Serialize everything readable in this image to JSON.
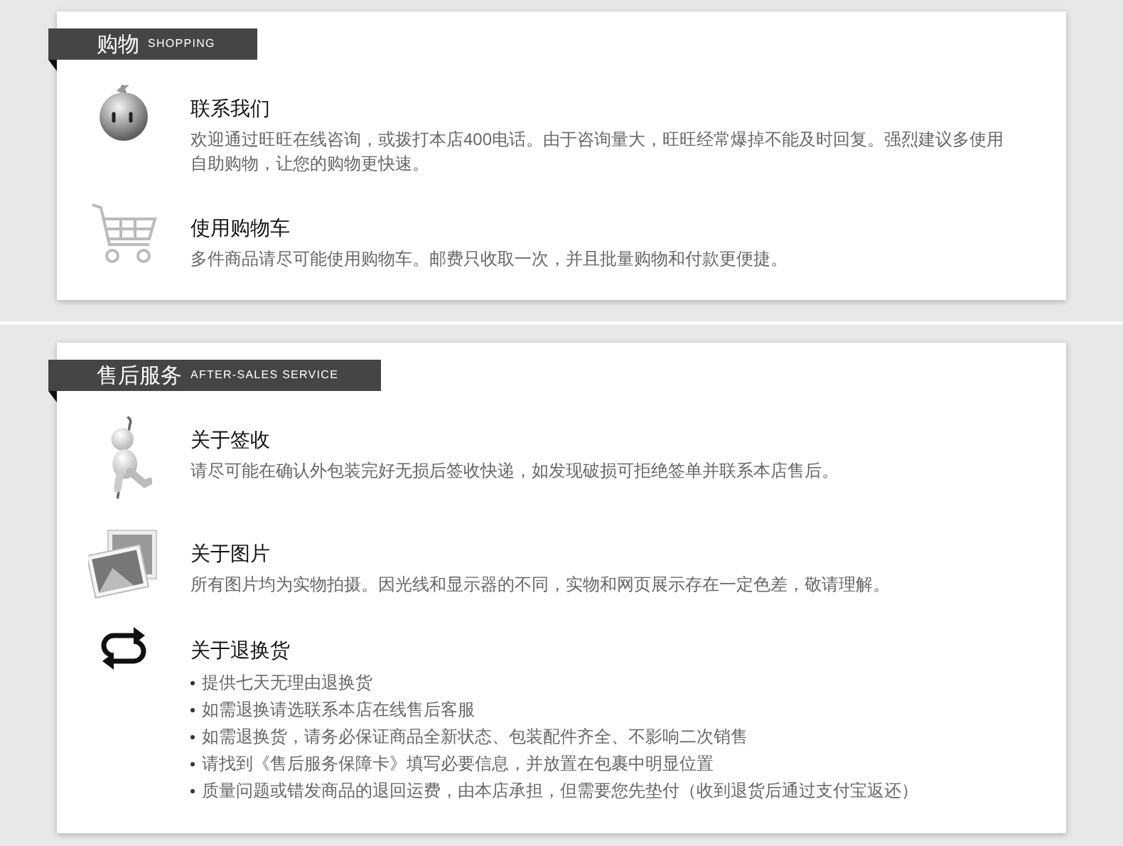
{
  "sections": [
    {
      "title": "购物",
      "subtitle": "SHOPPING",
      "items": [
        {
          "title": "联系我们",
          "text": "欢迎通过旺旺在线咨询，或拨打本店400电话。由于咨询量大，旺旺经常爆掉不能及时回复。强烈建议多使用自助购物，让您的购物更快速。"
        },
        {
          "title": "使用购物车",
          "text": "多件商品请尽可能使用购物车。邮费只收取一次，并且批量购物和付款更便捷。"
        }
      ]
    },
    {
      "title": "售后服务",
      "subtitle": "AFTER-SALES SERVICE",
      "items": [
        {
          "title": "关于签收",
          "text": "请尽可能在确认外包装完好无损后签收快递，如发现破损可拒绝签单并联系本店售后。"
        },
        {
          "title": "关于图片",
          "text": "所有图片均为实物拍摄。因光线和显示器的不同，实物和网页展示存在一定色差，敬请理解。"
        },
        {
          "title": "关于退换货",
          "bullets": [
            "提供七天无理由退换货",
            "如需退换请选联系本店在线售后客服",
            "如需退换货，请务必保证商品全新状态、包装配件齐全、不影响二次销售",
            "请找到《售后服务保障卡》填写必要信息，并放置在包裹中明显位置",
            "质量问题或错发商品的退回运费，由本店承担，但需要您先垫付（收到退货后通过支付宝返还）"
          ]
        }
      ]
    }
  ]
}
